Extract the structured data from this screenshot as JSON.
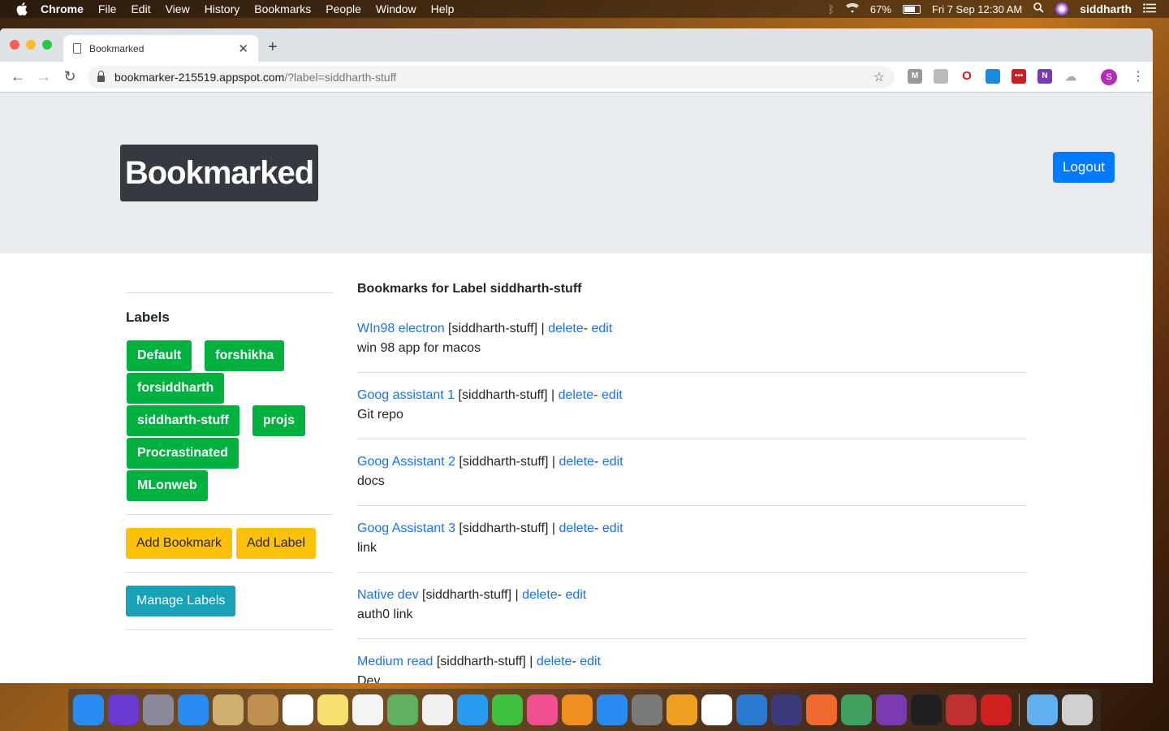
{
  "menubar": {
    "app_name": "Chrome",
    "items": [
      "File",
      "Edit",
      "View",
      "History",
      "Bookmarks",
      "People",
      "Window",
      "Help"
    ],
    "battery": "67%",
    "datetime": "Fri 7 Sep  12:30 AM",
    "user": "siddharth"
  },
  "browser": {
    "tab_title": "Bookmarked",
    "url_host": "bookmarker-215519.appspot.com",
    "url_path": "/?label=siddharth-stuff",
    "profile_initial": "S"
  },
  "header": {
    "brand": "Bookmarked",
    "logout_label": "Logout"
  },
  "sidebar": {
    "labels_title": "Labels",
    "labels": [
      "Default",
      "forshikha",
      "forsiddharth",
      "siddharth-stuff",
      "projs",
      "Procrastinated",
      "MLonweb"
    ],
    "add_bookmark_label": "Add Bookmark",
    "add_label_label": "Add Label",
    "manage_labels_label": "Manage Labels"
  },
  "main": {
    "title": "Bookmarks for Label siddharth-stuff",
    "bookmarks": [
      {
        "name": "WIn98 electron",
        "tag": " [siddharth-stuff] | ",
        "delete": "delete",
        "dash": "- ",
        "edit": "edit",
        "desc": "win 98 app for macos"
      },
      {
        "name": "Goog assistant 1",
        "tag": " [siddharth-stuff] | ",
        "delete": "delete",
        "dash": "- ",
        "edit": "edit",
        "desc": "Git repo"
      },
      {
        "name": "Goog Assistant 2",
        "tag": " [siddharth-stuff] | ",
        "delete": "delete",
        "dash": "- ",
        "edit": "edit",
        "desc": "docs"
      },
      {
        "name": "Goog Assistant 3",
        "tag": " [siddharth-stuff] | ",
        "delete": "delete",
        "dash": "- ",
        "edit": "edit",
        "desc": "link"
      },
      {
        "name": "Native dev",
        "tag": " [siddharth-stuff] | ",
        "delete": "delete",
        "dash": "- ",
        "edit": "edit",
        "desc": "auth0 link"
      },
      {
        "name": "Medium read",
        "tag": " [siddharth-stuff] | ",
        "delete": "delete",
        "dash": "- ",
        "edit": "edit",
        "desc": "Dev"
      }
    ]
  },
  "dock": {
    "apps": [
      "finder-icon",
      "siri-icon",
      "launchpad-icon",
      "safari-icon",
      "mail-icon",
      "contacts-icon",
      "calendar-icon",
      "notes-icon",
      "reminders-icon",
      "maps-icon",
      "photos-icon",
      "messages-icon",
      "facetime-icon",
      "itunes-icon",
      "books-icon",
      "app-store-icon",
      "system-preferences-icon",
      "sublime-icon",
      "chrome-icon",
      "vscode-icon",
      "eclipse-icon",
      "postman-icon",
      "robo3t-icon",
      "onenote-icon",
      "terminal-icon",
      "windows98-icon",
      "boxer-icon",
      "downloads-icon",
      "trash-icon"
    ],
    "colors": [
      "#2a8cf0",
      "#6a3ad0",
      "#8a8a9a",
      "#2a8cf0",
      "#d0b070",
      "#c09050",
      "#ffffff",
      "#f8e070",
      "#f4f4f4",
      "#60b060",
      "#f0f0f0",
      "#2a9cf0",
      "#40c040",
      "#f05090",
      "#f09020",
      "#2a8cf0",
      "#7a7a7a",
      "#f0a020",
      "#ffffff",
      "#2a7ad0",
      "#3a3a7a",
      "#f06a30",
      "#40a060",
      "#7a3ab0",
      "#202020",
      "#c03030",
      "#d02020",
      "#60b0f0",
      "#d0d0d0"
    ]
  }
}
